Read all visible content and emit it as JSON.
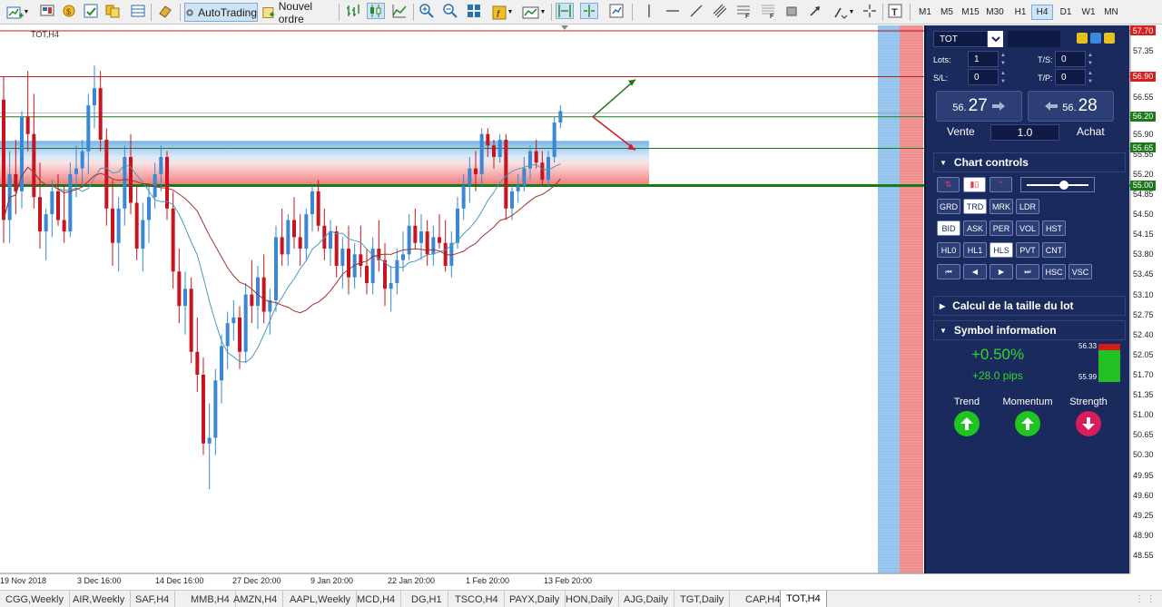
{
  "toolbar": {
    "autotrading_label": "AutoTrading",
    "new_order_label": "Nouvel ordre",
    "timeframes": [
      "M1",
      "M5",
      "M15",
      "M30",
      "H1",
      "H4",
      "D1",
      "W1",
      "MN"
    ],
    "active_timeframe": "H4"
  },
  "chart": {
    "symbol_tag": "TOT,H4",
    "price_levels": [
      "57.70",
      "57.35",
      "56.90",
      "56.55",
      "56.20",
      "55.90",
      "55.55",
      "55.20",
      "54.85",
      "54.50",
      "54.15",
      "53.80",
      "53.45",
      "53.10",
      "52.75",
      "52.40",
      "52.05",
      "51.70",
      "51.35",
      "51.00",
      "50.65",
      "50.30",
      "49.95",
      "49.60",
      "49.25",
      "48.90",
      "48.55"
    ],
    "badges": [
      {
        "value": "57.70",
        "color": "#d32020"
      },
      {
        "value": "56.90",
        "color": "#d32020"
      },
      {
        "value": "56.20",
        "color": "#1a7a1a"
      },
      {
        "value": "55.65",
        "color": "#1a7a1a"
      },
      {
        "value": "55.00",
        "color": "#1a7a1a"
      }
    ],
    "dates": [
      "19 Nov 2018",
      "3 Dec 16:00",
      "14 Dec 16:00",
      "27 Dec 20:00",
      "9 Jan 20:00",
      "22 Jan 20:00",
      "1 Feb 20:00",
      "13 Feb 20:00"
    ],
    "colors": {
      "bull": "#3a87d6",
      "bear": "#c8141e",
      "ma_fast": "#4a9ab8",
      "ma_slow": "#a03030"
    }
  },
  "panel": {
    "symbol": "TOT",
    "lots_label": "Lots:",
    "lots_value": "1",
    "sl_label": "S/L:",
    "sl_value": "0",
    "ts_label": "T/S:",
    "ts_value": "0",
    "tp_label": "T/P:",
    "tp_value": "0",
    "sell_small": "56.",
    "sell_big": "27",
    "buy_small": "56.",
    "buy_big": "28",
    "sell_label": "Vente",
    "buy_label": "Achat",
    "volume": "1.0",
    "chart_controls_title": "Chart controls",
    "buttons_row1": [
      "GRD",
      "TRD",
      "MRK",
      "LDR"
    ],
    "buttons_row2": [
      "BID",
      "ASK",
      "PER",
      "VOL",
      "HST"
    ],
    "buttons_row3": [
      "HL0",
      "HL1",
      "HLS",
      "PVT",
      "CNT"
    ],
    "buttons_row4_text": [
      "HSC",
      "VSC"
    ],
    "lot_calc_title": "Calcul de la taille du lot",
    "symbol_info_title": "Symbol information",
    "change_pct": "+0.50%",
    "change_pips": "+28.0 pips",
    "range_high": "56.33",
    "range_low": "55.99",
    "trend_label": "Trend",
    "momentum_label": "Momentum",
    "strength_label": "Strength"
  },
  "tabs": [
    "CGG,Weekly",
    "AIR,Weekly",
    "SAF,H4",
    "MMB,H4",
    "AMZN,H4",
    "AAPL,Weekly",
    "MCD,H4",
    "DG,H1",
    "TSCO,H4",
    "PAYX,Daily",
    "HON,Daily",
    "AJG,Daily",
    "TGT,Daily",
    "CAP,H4",
    "TOT,H4"
  ],
  "active_tab": "TOT,H4",
  "candles": [
    [
      0,
      56.5,
      56.9,
      54.0,
      54.4
    ],
    [
      1,
      54.4,
      55.6,
      54.0,
      55.2
    ],
    [
      2,
      55.2,
      55.8,
      54.5,
      54.9
    ],
    [
      3,
      54.9,
      56.3,
      54.6,
      56.2
    ],
    [
      4,
      56.2,
      57.0,
      55.6,
      55.9
    ],
    [
      5,
      55.9,
      56.6,
      54.6,
      54.8
    ],
    [
      6,
      54.8,
      55.4,
      53.9,
      54.2
    ],
    [
      7,
      54.2,
      54.6,
      53.7,
      54.5
    ],
    [
      8,
      54.5,
      55.1,
      54.1,
      54.9
    ],
    [
      9,
      54.9,
      55.2,
      54.3,
      54.4
    ],
    [
      10,
      54.4,
      55.0,
      54.0,
      54.2
    ],
    [
      11,
      54.2,
      55.4,
      54.1,
      55.2
    ],
    [
      12,
      55.2,
      55.7,
      54.8,
      55.3
    ],
    [
      13,
      55.3,
      55.8,
      55.0,
      55.6
    ],
    [
      14,
      55.6,
      56.6,
      55.2,
      56.4
    ],
    [
      15,
      56.4,
      57.1,
      56.0,
      56.7
    ],
    [
      16,
      56.7,
      57.0,
      55.6,
      55.8
    ],
    [
      17,
      55.8,
      56.0,
      54.3,
      54.6
    ],
    [
      18,
      54.6,
      55.1,
      53.6,
      54.0
    ],
    [
      19,
      54.0,
      54.8,
      53.5,
      54.6
    ],
    [
      20,
      54.6,
      55.7,
      54.3,
      55.5
    ],
    [
      21,
      55.5,
      55.9,
      54.5,
      54.7
    ],
    [
      22,
      54.7,
      55.0,
      53.7,
      53.9
    ],
    [
      23,
      53.9,
      54.7,
      53.5,
      54.4
    ],
    [
      24,
      54.4,
      55.0,
      54.0,
      54.8
    ],
    [
      25,
      54.8,
      55.4,
      54.6,
      55.2
    ],
    [
      26,
      55.2,
      55.7,
      54.9,
      55.5
    ],
    [
      27,
      55.5,
      55.6,
      54.4,
      54.6
    ],
    [
      28,
      54.6,
      54.9,
      53.2,
      53.5
    ],
    [
      29,
      53.5,
      53.9,
      52.6,
      52.9
    ],
    [
      30,
      52.9,
      53.5,
      52.4,
      53.2
    ],
    [
      31,
      53.2,
      53.4,
      51.9,
      52.1
    ],
    [
      32,
      52.1,
      52.7,
      51.4,
      51.7
    ],
    [
      33,
      51.7,
      52.0,
      50.3,
      50.5
    ],
    [
      34,
      50.5,
      51.2,
      49.7,
      50.6
    ],
    [
      35,
      50.6,
      51.8,
      50.3,
      51.6
    ],
    [
      36,
      51.6,
      52.4,
      51.2,
      52.2
    ],
    [
      37,
      52.2,
      52.8,
      51.8,
      52.6
    ],
    [
      38,
      52.6,
      53.0,
      52.3,
      52.7
    ],
    [
      39,
      52.7,
      52.9,
      51.8,
      52.1
    ],
    [
      40,
      52.1,
      53.3,
      51.9,
      53.1
    ],
    [
      41,
      53.1,
      53.7,
      52.6,
      52.9
    ],
    [
      42,
      52.9,
      53.6,
      52.5,
      53.4
    ],
    [
      43,
      53.4,
      53.8,
      52.6,
      52.8
    ],
    [
      44,
      52.8,
      53.2,
      52.4,
      53.0
    ],
    [
      45,
      53.0,
      54.3,
      52.8,
      54.1
    ],
    [
      46,
      54.1,
      54.6,
      53.6,
      53.8
    ],
    [
      47,
      53.8,
      54.5,
      53.6,
      54.4
    ],
    [
      48,
      54.4,
      54.8,
      53.9,
      54.1
    ],
    [
      49,
      54.1,
      54.5,
      53.6,
      53.9
    ],
    [
      50,
      53.9,
      54.6,
      53.7,
      54.5
    ],
    [
      51,
      54.5,
      55.0,
      54.2,
      54.9
    ],
    [
      52,
      54.9,
      55.1,
      54.2,
      54.3
    ],
    [
      53,
      54.3,
      54.6,
      53.7,
      53.9
    ],
    [
      54,
      53.9,
      54.4,
      53.6,
      54.2
    ],
    [
      55,
      54.2,
      54.3,
      53.4,
      53.6
    ],
    [
      56,
      53.6,
      54.1,
      53.2,
      53.9
    ],
    [
      57,
      53.9,
      54.3,
      53.1,
      53.4
    ],
    [
      58,
      53.4,
      54.0,
      53.2,
      53.8
    ],
    [
      59,
      53.8,
      54.3,
      53.4,
      53.6
    ],
    [
      60,
      53.6,
      53.9,
      53.1,
      53.3
    ],
    [
      61,
      53.3,
      54.1,
      53.1,
      53.9
    ],
    [
      62,
      53.9,
      54.4,
      53.5,
      53.7
    ],
    [
      63,
      53.7,
      54.0,
      52.9,
      53.2
    ],
    [
      64,
      53.2,
      53.6,
      52.8,
      53.3
    ],
    [
      65,
      53.3,
      53.9,
      53.1,
      53.7
    ],
    [
      66,
      53.7,
      54.2,
      53.5,
      53.8
    ],
    [
      67,
      53.8,
      54.5,
      53.7,
      54.3
    ],
    [
      68,
      54.3,
      54.6,
      53.9,
      54.0
    ],
    [
      69,
      54.0,
      54.5,
      53.7,
      54.2
    ],
    [
      70,
      54.2,
      54.4,
      53.6,
      53.8
    ],
    [
      71,
      53.8,
      54.3,
      53.6,
      54.1
    ],
    [
      72,
      54.1,
      54.5,
      53.9,
      54.0
    ],
    [
      73,
      54.0,
      54.4,
      53.5,
      53.6
    ],
    [
      74,
      53.6,
      54.2,
      53.4,
      54.0
    ],
    [
      75,
      54.0,
      54.8,
      53.9,
      54.6
    ],
    [
      76,
      54.6,
      55.2,
      54.4,
      55.0
    ],
    [
      77,
      55.0,
      55.5,
      54.7,
      55.3
    ],
    [
      78,
      55.3,
      55.6,
      54.9,
      55.2
    ],
    [
      79,
      55.2,
      56.0,
      55.0,
      55.9
    ],
    [
      80,
      55.9,
      56.0,
      55.5,
      55.7
    ],
    [
      81,
      55.7,
      55.8,
      55.3,
      55.5
    ],
    [
      82,
      55.5,
      55.9,
      55.4,
      55.8
    ],
    [
      83,
      55.8,
      55.9,
      54.4,
      54.6
    ],
    [
      84,
      54.6,
      55.0,
      54.4,
      54.9
    ],
    [
      85,
      54.9,
      55.2,
      54.7,
      55.0
    ],
    [
      86,
      55.0,
      55.5,
      54.9,
      55.3
    ],
    [
      87,
      55.3,
      55.7,
      55.1,
      55.6
    ],
    [
      88,
      55.6,
      55.8,
      55.3,
      55.4
    ],
    [
      89,
      55.4,
      55.6,
      55.0,
      55.1
    ],
    [
      90,
      55.1,
      55.6,
      55.0,
      55.5
    ],
    [
      91,
      55.5,
      56.2,
      55.4,
      56.1
    ],
    [
      92,
      56.1,
      56.4,
      56.0,
      56.3
    ]
  ]
}
